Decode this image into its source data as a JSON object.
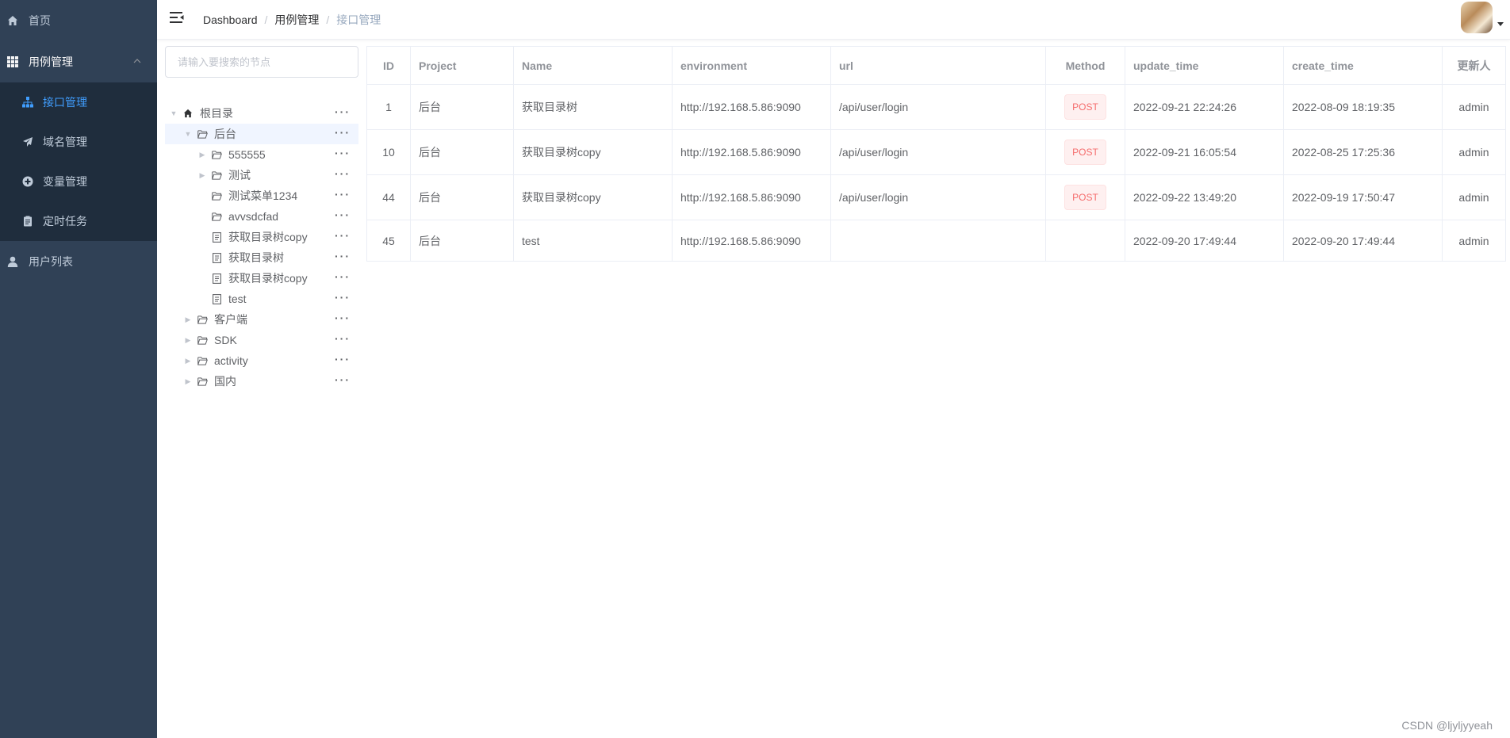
{
  "sidebar": {
    "items": [
      {
        "label": "首页",
        "icon": "home-icon"
      },
      {
        "label": "用例管理",
        "icon": "grid-icon"
      },
      {
        "label": "用户列表",
        "icon": "user-icon"
      }
    ],
    "submenu": [
      {
        "label": "接口管理",
        "icon": "sitemap-icon"
      },
      {
        "label": "域名管理",
        "icon": "send-icon"
      },
      {
        "label": "变量管理",
        "icon": "plus-circle-icon"
      },
      {
        "label": "定时任务",
        "icon": "clipboard-icon"
      }
    ]
  },
  "header": {
    "breadcrumb": [
      "Dashboard",
      "用例管理",
      "接口管理"
    ]
  },
  "tree": {
    "search_placeholder": "请输入要搜索的节点",
    "more": "···",
    "nodes": [
      {
        "label": "根目录",
        "type": "home",
        "level": 0,
        "caret": "open"
      },
      {
        "label": "后台",
        "type": "folder",
        "level": 1,
        "caret": "open",
        "selected": true
      },
      {
        "label": "555555",
        "type": "folder",
        "level": 2,
        "caret": "closed"
      },
      {
        "label": "测试",
        "type": "folder",
        "level": 2,
        "caret": "closed"
      },
      {
        "label": "测试菜单1234",
        "type": "folder",
        "level": 2,
        "caret": "none"
      },
      {
        "label": "avvsdcfad",
        "type": "folder",
        "level": 2,
        "caret": "none"
      },
      {
        "label": "获取目录树copy",
        "type": "doc",
        "level": 2,
        "caret": "none"
      },
      {
        "label": "获取目录树",
        "type": "doc",
        "level": 2,
        "caret": "none"
      },
      {
        "label": "获取目录树copy",
        "type": "doc",
        "level": 2,
        "caret": "none"
      },
      {
        "label": "test",
        "type": "doc",
        "level": 2,
        "caret": "none"
      },
      {
        "label": "客户端",
        "type": "folder",
        "level": 1,
        "caret": "closed"
      },
      {
        "label": "SDK",
        "type": "folder",
        "level": 1,
        "caret": "closed"
      },
      {
        "label": "activity",
        "type": "folder",
        "level": 1,
        "caret": "closed"
      },
      {
        "label": "国内",
        "type": "folder",
        "level": 1,
        "caret": "closed"
      }
    ]
  },
  "table": {
    "columns": [
      "ID",
      "Project",
      "Name",
      "environment",
      "url",
      "Method",
      "update_time",
      "create_time",
      "更新人"
    ],
    "rows": [
      {
        "id": "1",
        "project": "后台",
        "name": "获取目录树",
        "environment": "http://192.168.5.86:9090",
        "url": "/api/user/login",
        "method": "POST",
        "update_time": "2022-09-21 22:24:26",
        "create_time": "2022-08-09 18:19:35",
        "updater": "admin"
      },
      {
        "id": "10",
        "project": "后台",
        "name": "获取目录树copy",
        "environment": "http://192.168.5.86:9090",
        "url": "/api/user/login",
        "method": "POST",
        "update_time": "2022-09-21 16:05:54",
        "create_time": "2022-08-25 17:25:36",
        "updater": "admin"
      },
      {
        "id": "44",
        "project": "后台",
        "name": "获取目录树copy",
        "environment": "http://192.168.5.86:9090",
        "url": "/api/user/login",
        "method": "POST",
        "update_time": "2022-09-22 13:49:20",
        "create_time": "2022-09-19 17:50:47",
        "updater": "admin"
      },
      {
        "id": "45",
        "project": "后台",
        "name": "test",
        "environment": "http://192.168.5.86:9090",
        "url": "",
        "method": "",
        "update_time": "2022-09-20 17:49:44",
        "create_time": "2022-09-20 17:49:44",
        "updater": "admin"
      }
    ]
  },
  "watermark": "CSDN @ljyljyyeah",
  "colors": {
    "sidebar_bg": "#304156",
    "submenu_bg": "#1f2d3d",
    "active": "#409eff",
    "post_tag": "#f56c6c"
  }
}
